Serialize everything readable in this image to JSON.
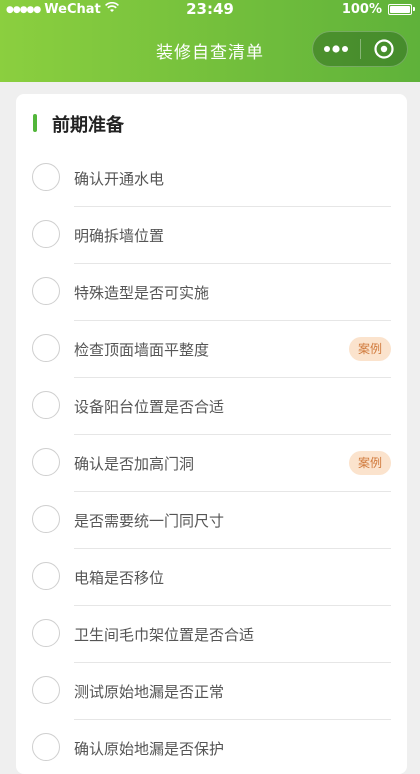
{
  "status_bar": {
    "signal": "●●●●●",
    "carrier": "WeChat",
    "time": "23:49",
    "battery_text": "100%",
    "battery_level": 1.0
  },
  "nav": {
    "title": "装修自查清单",
    "more_icon": "ellipsis-icon",
    "close_icon": "target-circle-icon"
  },
  "section": {
    "title": "前期准备",
    "accent_color": "#52b63a"
  },
  "colors": {
    "header_start": "#8bcf3f",
    "header_end": "#5fb23a",
    "badge_bg": "#fbe3cd",
    "badge_text": "#d07a3c"
  },
  "items": [
    {
      "label": "确认开通水电",
      "badge": null
    },
    {
      "label": "明确拆墙位置",
      "badge": null
    },
    {
      "label": "特殊造型是否可实施",
      "badge": null
    },
    {
      "label": "检查顶面墙面平整度",
      "badge": "案例"
    },
    {
      "label": "设备阳台位置是否合适",
      "badge": null
    },
    {
      "label": "确认是否加高门洞",
      "badge": "案例"
    },
    {
      "label": "是否需要统一门同尺寸",
      "badge": null
    },
    {
      "label": "电箱是否移位",
      "badge": null
    },
    {
      "label": "卫生间毛巾架位置是否合适",
      "badge": null
    },
    {
      "label": "测试原始地漏是否正常",
      "badge": null
    },
    {
      "label": "确认原始地漏是否保护",
      "badge": null
    }
  ]
}
